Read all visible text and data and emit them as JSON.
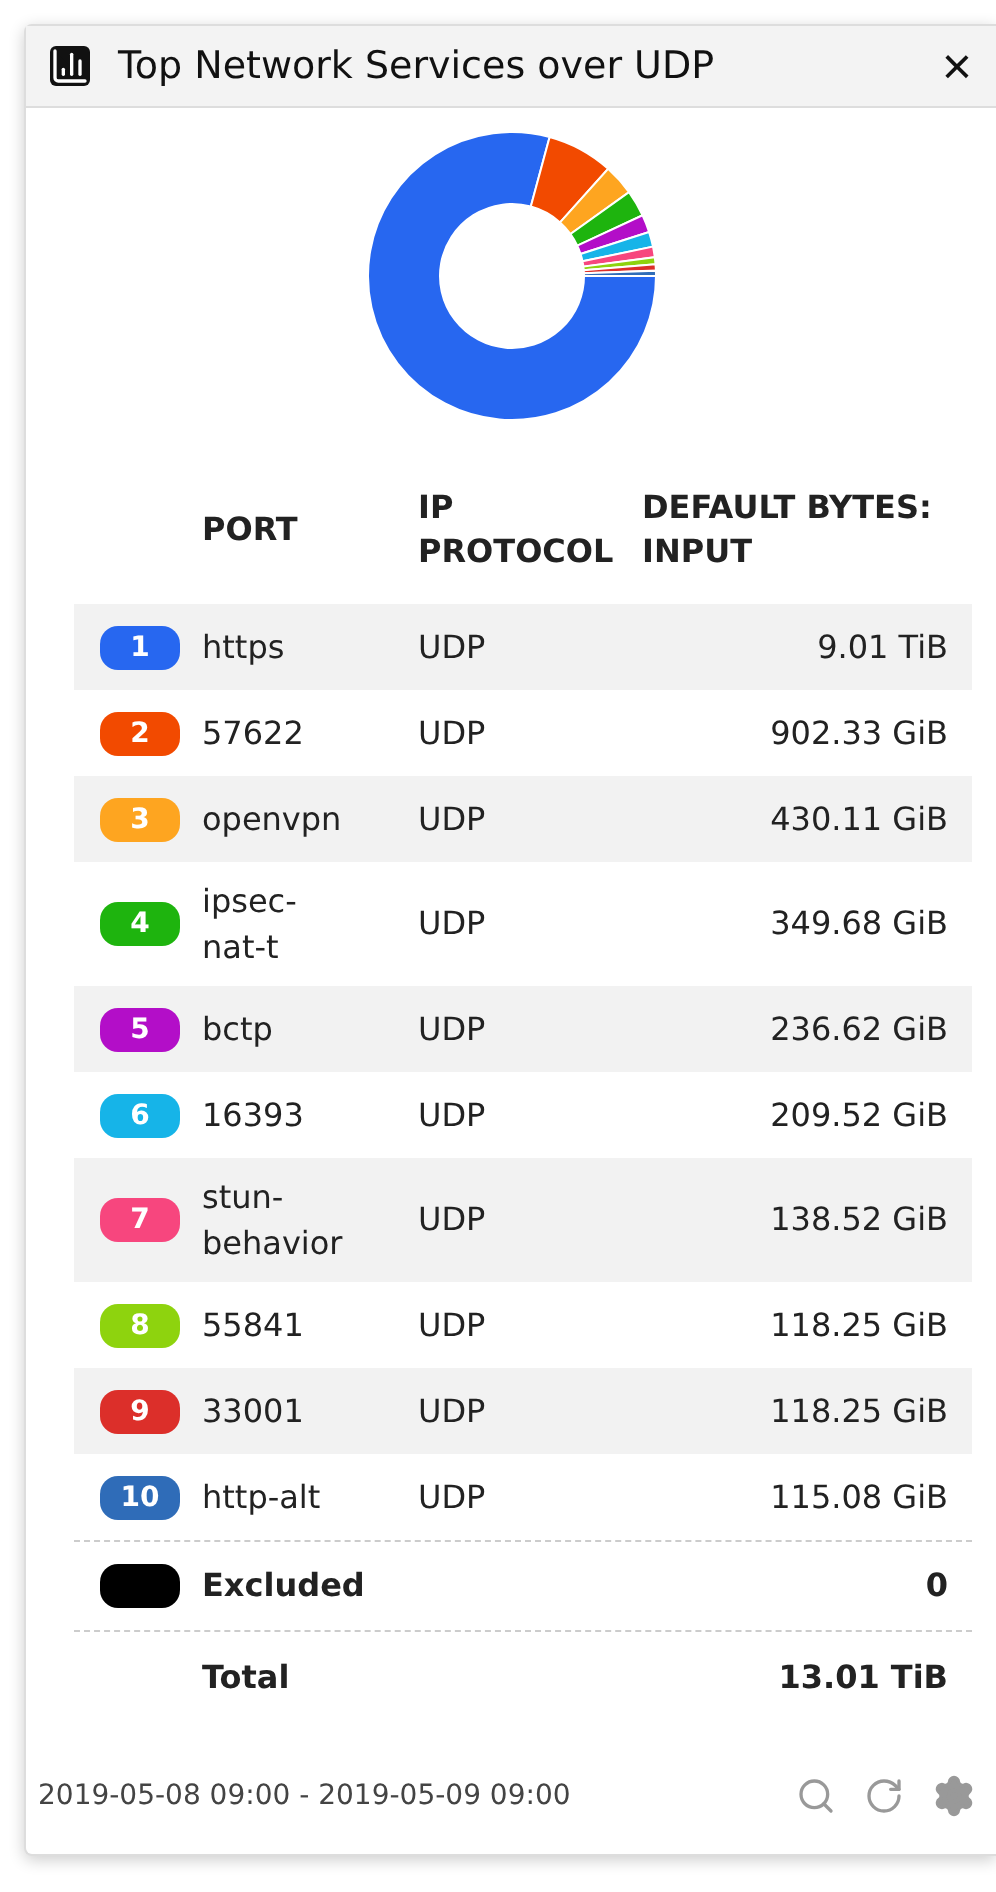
{
  "window": {
    "title": "Top Network Services over UDP",
    "close": "×"
  },
  "table": {
    "columns": [
      "PORT",
      "IP PROTOCOL",
      "DEFAULT BYTES: INPUT"
    ],
    "rows": [
      {
        "rank": "1",
        "color": "#2767f0",
        "port": "https",
        "protocol": "UDP",
        "bytes": "9.01 TiB"
      },
      {
        "rank": "2",
        "color": "#f24a00",
        "port": "57622",
        "protocol": "UDP",
        "bytes": "902.33 GiB"
      },
      {
        "rank": "3",
        "color": "#fea520",
        "port": "openvpn",
        "protocol": "UDP",
        "bytes": "430.11 GiB"
      },
      {
        "rank": "4",
        "color": "#1eb40e",
        "port": "ipsec-\nnat-t",
        "protocol": "UDP",
        "bytes": "349.68 GiB"
      },
      {
        "rank": "5",
        "color": "#b30ec8",
        "port": "bctp",
        "protocol": "UDP",
        "bytes": "236.62 GiB"
      },
      {
        "rank": "6",
        "color": "#16b4e8",
        "port": "16393",
        "protocol": "UDP",
        "bytes": "209.52 GiB"
      },
      {
        "rank": "7",
        "color": "#f7467e",
        "port": "stun-\nbehavior",
        "protocol": "UDP",
        "bytes": "138.52 GiB"
      },
      {
        "rank": "8",
        "color": "#8ed30e",
        "port": "55841",
        "protocol": "UDP",
        "bytes": "118.25 GiB"
      },
      {
        "rank": "9",
        "color": "#dc2f2a",
        "port": "33001",
        "protocol": "UDP",
        "bytes": "118.25 GiB"
      },
      {
        "rank": "10",
        "color": "#2f6cb8",
        "port": "http-alt",
        "protocol": "UDP",
        "bytes": "115.08 GiB"
      }
    ],
    "excluded": {
      "color": "#000000",
      "label": "Excluded",
      "bytes": "0"
    },
    "total": {
      "label": "Total",
      "bytes": "13.01 TiB"
    }
  },
  "footer": {
    "range": "2019-05-08 09:00 - 2019-05-09 09:00"
  }
}
